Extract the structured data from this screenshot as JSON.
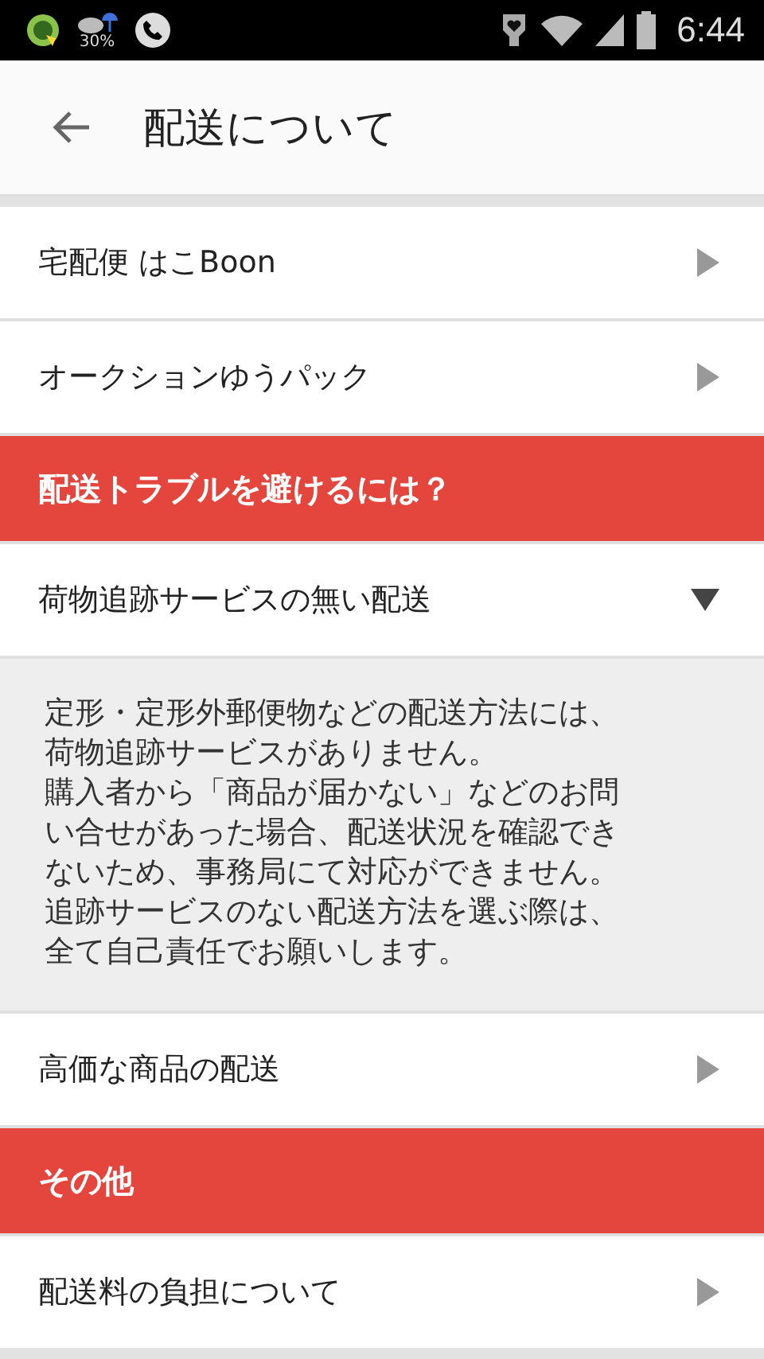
{
  "status_bar": {
    "weather": "30%",
    "time": "6:44"
  },
  "app_bar": {
    "title": "配送について"
  },
  "items": [
    {
      "kind": "link",
      "label": "宅配便 はこBoon"
    },
    {
      "kind": "link",
      "label": "オークションゆうパック"
    },
    {
      "kind": "header",
      "label": "配送トラブルを避けるには？"
    },
    {
      "kind": "accordion",
      "label": "荷物追跡サービスの無い配送",
      "expanded": true,
      "detail": [
        "定形・定形外郵便物などの配送方法には、",
        "荷物追跡サービスがありません。",
        "購入者から「商品が届かない」などのお問",
        "い合せがあった場合、配送状況を確認でき",
        "ないため、事務局にて対応ができません。",
        "追跡サービスのない配送方法を選ぶ際は、",
        "全て自己責任でお願いします。"
      ]
    },
    {
      "kind": "accordion",
      "label": "高価な商品の配送",
      "expanded": false
    },
    {
      "kind": "header",
      "label": "その他"
    },
    {
      "kind": "link",
      "label": "配送料の負担について"
    }
  ]
}
